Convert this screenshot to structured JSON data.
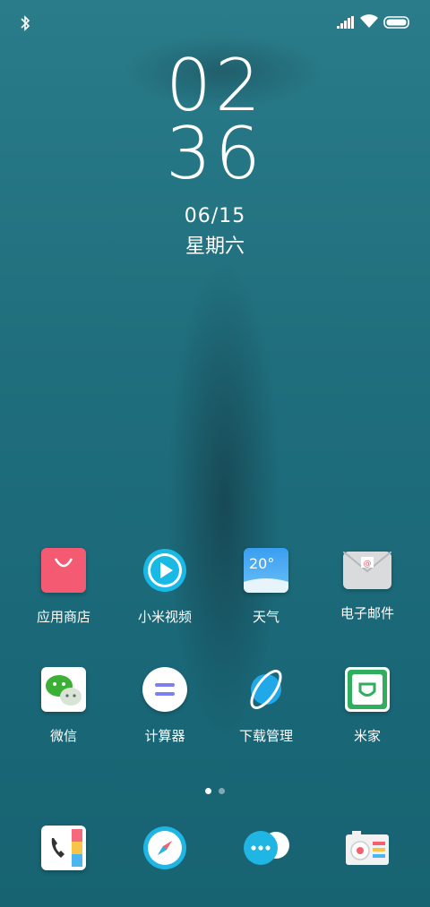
{
  "status_bar": {
    "left_icons": [
      "bluetooth-icon"
    ],
    "right_icons": [
      "signal-icon",
      "wifi-icon",
      "battery-icon"
    ]
  },
  "clock": {
    "hours": "02",
    "minutes": "36",
    "date": "06/15",
    "weekday": "星期六"
  },
  "apps_row1": [
    {
      "label": "应用商店",
      "icon": "app-store-icon",
      "color": "#f45b72"
    },
    {
      "label": "小米视频",
      "icon": "video-icon",
      "color": "#19b9e6"
    },
    {
      "label": "天气",
      "icon": "weather-icon",
      "badge": "20°",
      "color": "#3a9ef0"
    },
    {
      "label": "电子邮件",
      "icon": "email-icon",
      "color": "#d9dbdd"
    }
  ],
  "apps_row2": [
    {
      "label": "微信",
      "icon": "wechat-icon",
      "color": "#3cb034"
    },
    {
      "label": "计算器",
      "icon": "calculator-icon",
      "color": "#ffffff"
    },
    {
      "label": "下载管理",
      "icon": "download-icon",
      "color": "#21a8e8"
    },
    {
      "label": "米家",
      "icon": "mijia-icon",
      "color": "#2fae5e"
    }
  ],
  "page_indicator": {
    "pages": 2,
    "active": 1
  },
  "dock": [
    {
      "icon": "phone-icon"
    },
    {
      "icon": "browser-icon"
    },
    {
      "icon": "messages-icon"
    },
    {
      "icon": "camera-icon"
    }
  ]
}
